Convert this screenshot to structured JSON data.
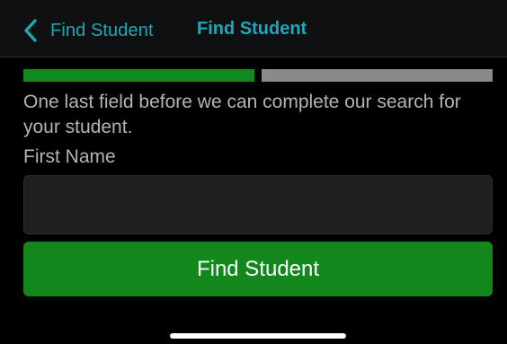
{
  "nav": {
    "back_label": "Find Student",
    "title": "Find Student",
    "accent_color": "#1fa7b6"
  },
  "progress": {
    "completed_steps": 1,
    "total_steps": 2,
    "done_color": "#0e8a1f",
    "todo_color": "#8a8a8a"
  },
  "form": {
    "instructions": "One last field before we can complete our search for your student.",
    "first_name_label": "First Name",
    "first_name_value": "",
    "submit_label": "Find Student",
    "submit_color": "#12881c"
  },
  "icons": {
    "back": "chevron-left-icon"
  }
}
